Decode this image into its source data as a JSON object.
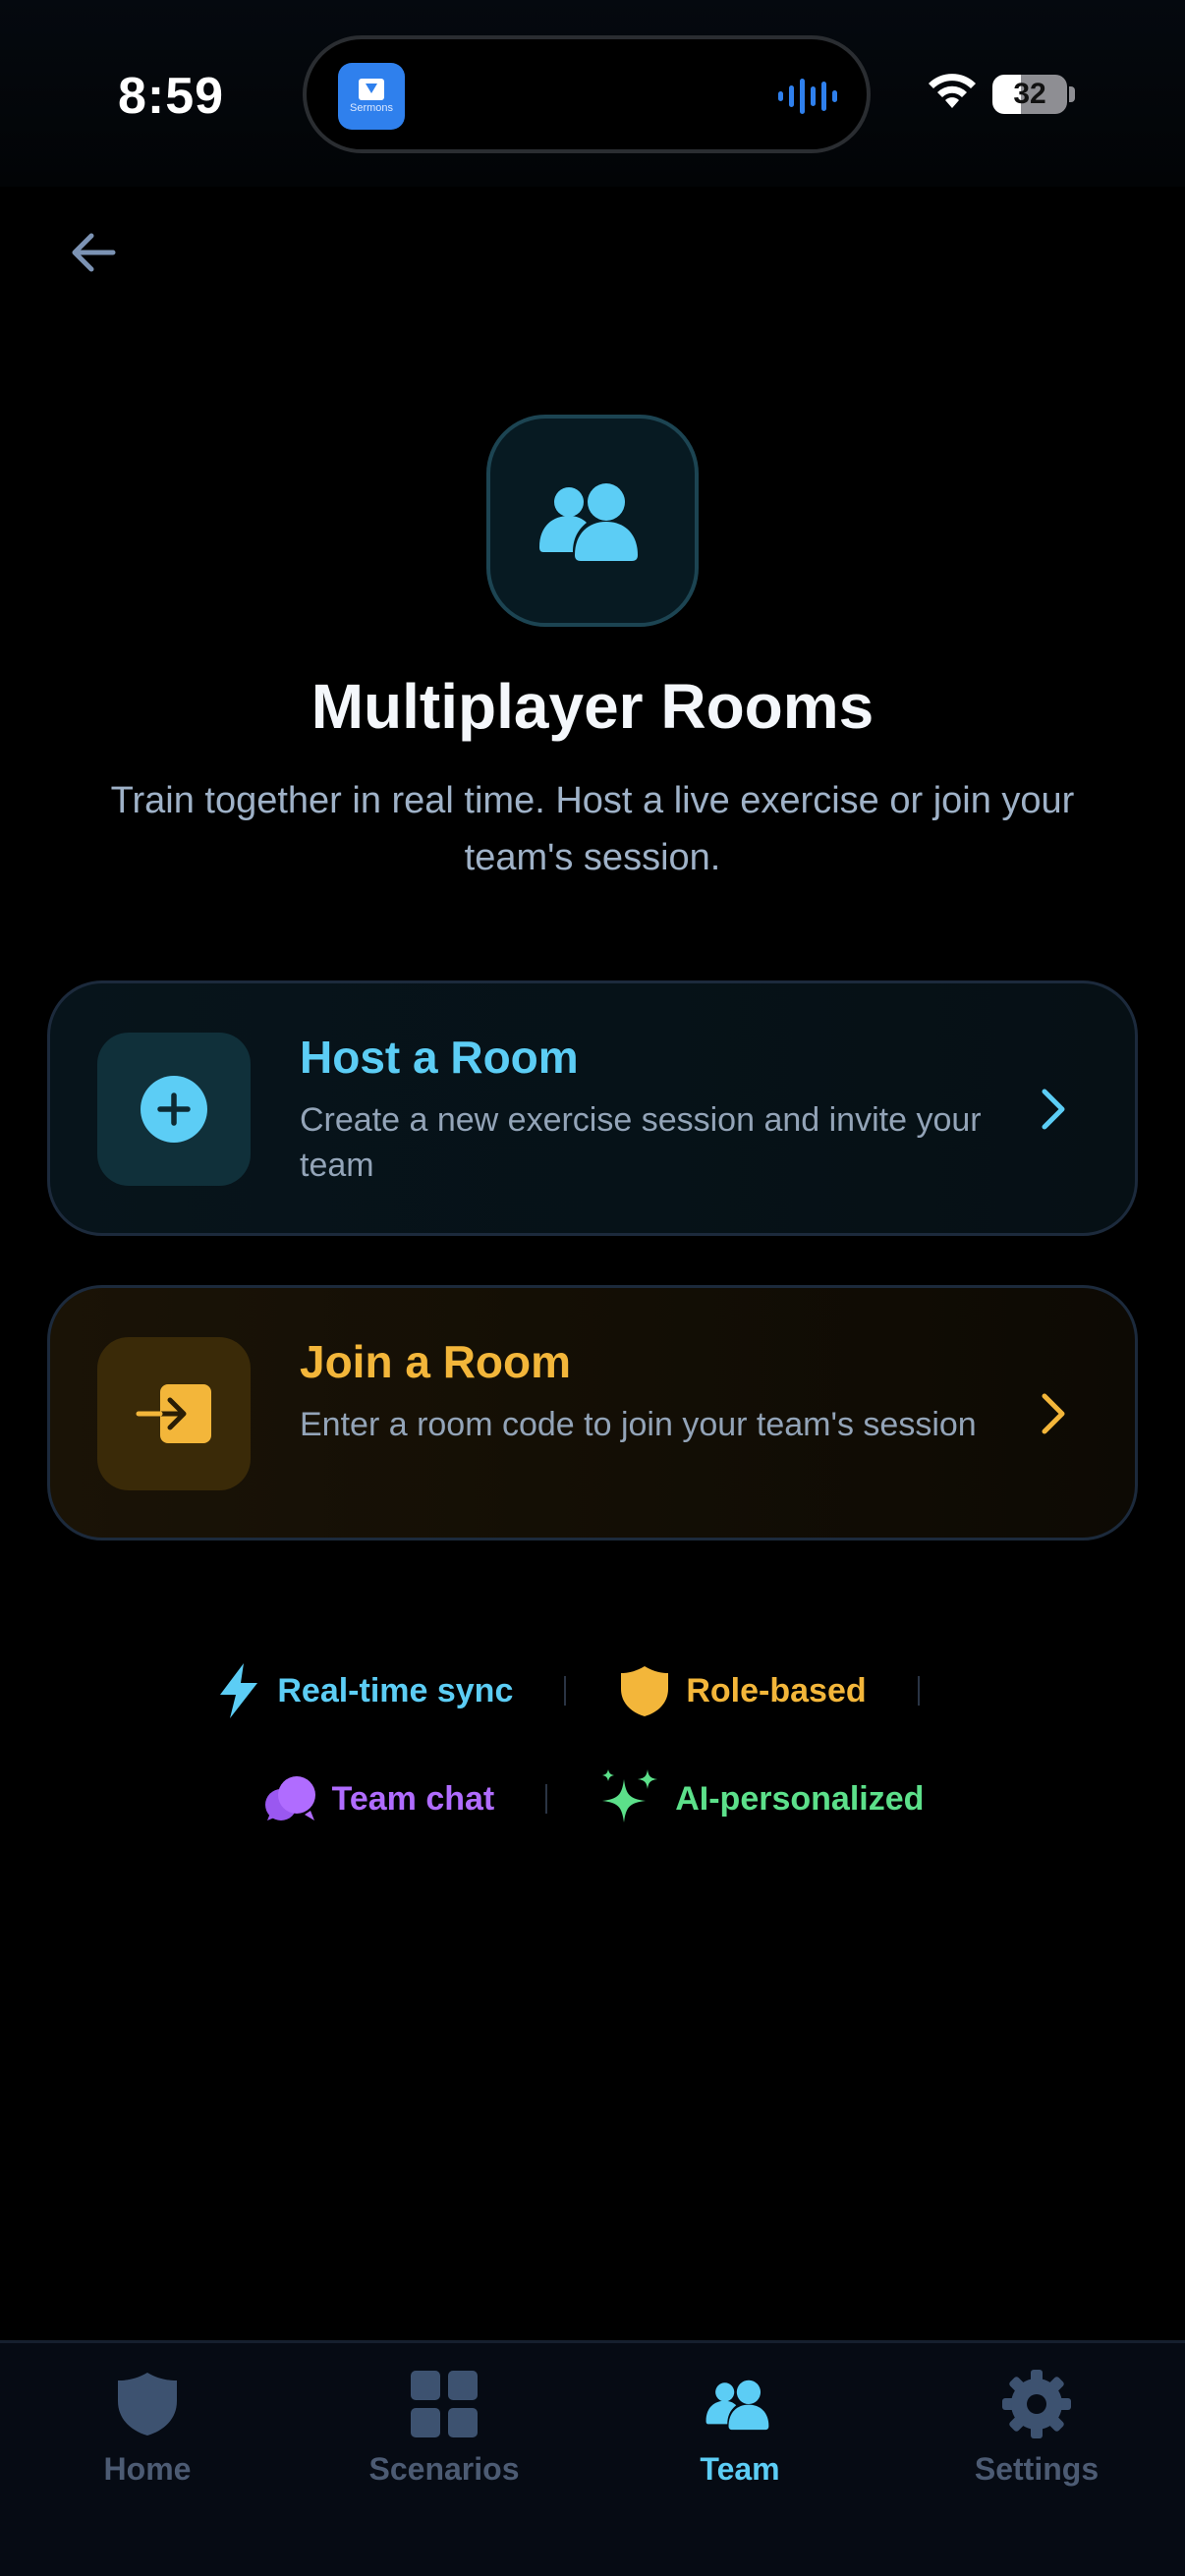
{
  "status_bar": {
    "time": "8:59",
    "battery": "32",
    "island_app_label": "Sermons"
  },
  "colors": {
    "accent_blue": "#5ccdf5",
    "accent_yellow": "#f3b63a",
    "accent_purple": "#b06cff",
    "accent_green": "#5ce08a",
    "background": "#000000",
    "tab_inactive": "#4c5b73"
  },
  "header": {
    "back_icon": "arrow-left-icon"
  },
  "hero": {
    "icon": "users-icon",
    "title": "Multiplayer Rooms",
    "subtitle": "Train together in real time. Host a live exercise or join your team's session."
  },
  "cards": {
    "host": {
      "icon": "plus-circle-icon",
      "title": "Host a Room",
      "description": "Create a new exercise session and invite your team"
    },
    "join": {
      "icon": "enter-icon",
      "title": "Join a Room",
      "description": "Enter a room code to join your team's session"
    }
  },
  "features": [
    {
      "icon": "lightning-icon",
      "label": "Real-time sync"
    },
    {
      "icon": "shield-icon",
      "label": "Role-based"
    },
    {
      "icon": "chat-bubbles-icon",
      "label": "Team chat"
    },
    {
      "icon": "sparkles-icon",
      "label": "AI-personalized"
    }
  ],
  "tab_bar": {
    "tabs": [
      {
        "label": "Home",
        "icon": "shield-icon",
        "active": false
      },
      {
        "label": "Scenarios",
        "icon": "grid-icon",
        "active": false
      },
      {
        "label": "Team",
        "icon": "users-icon",
        "active": true
      },
      {
        "label": "Settings",
        "icon": "gear-icon",
        "active": false
      }
    ]
  }
}
